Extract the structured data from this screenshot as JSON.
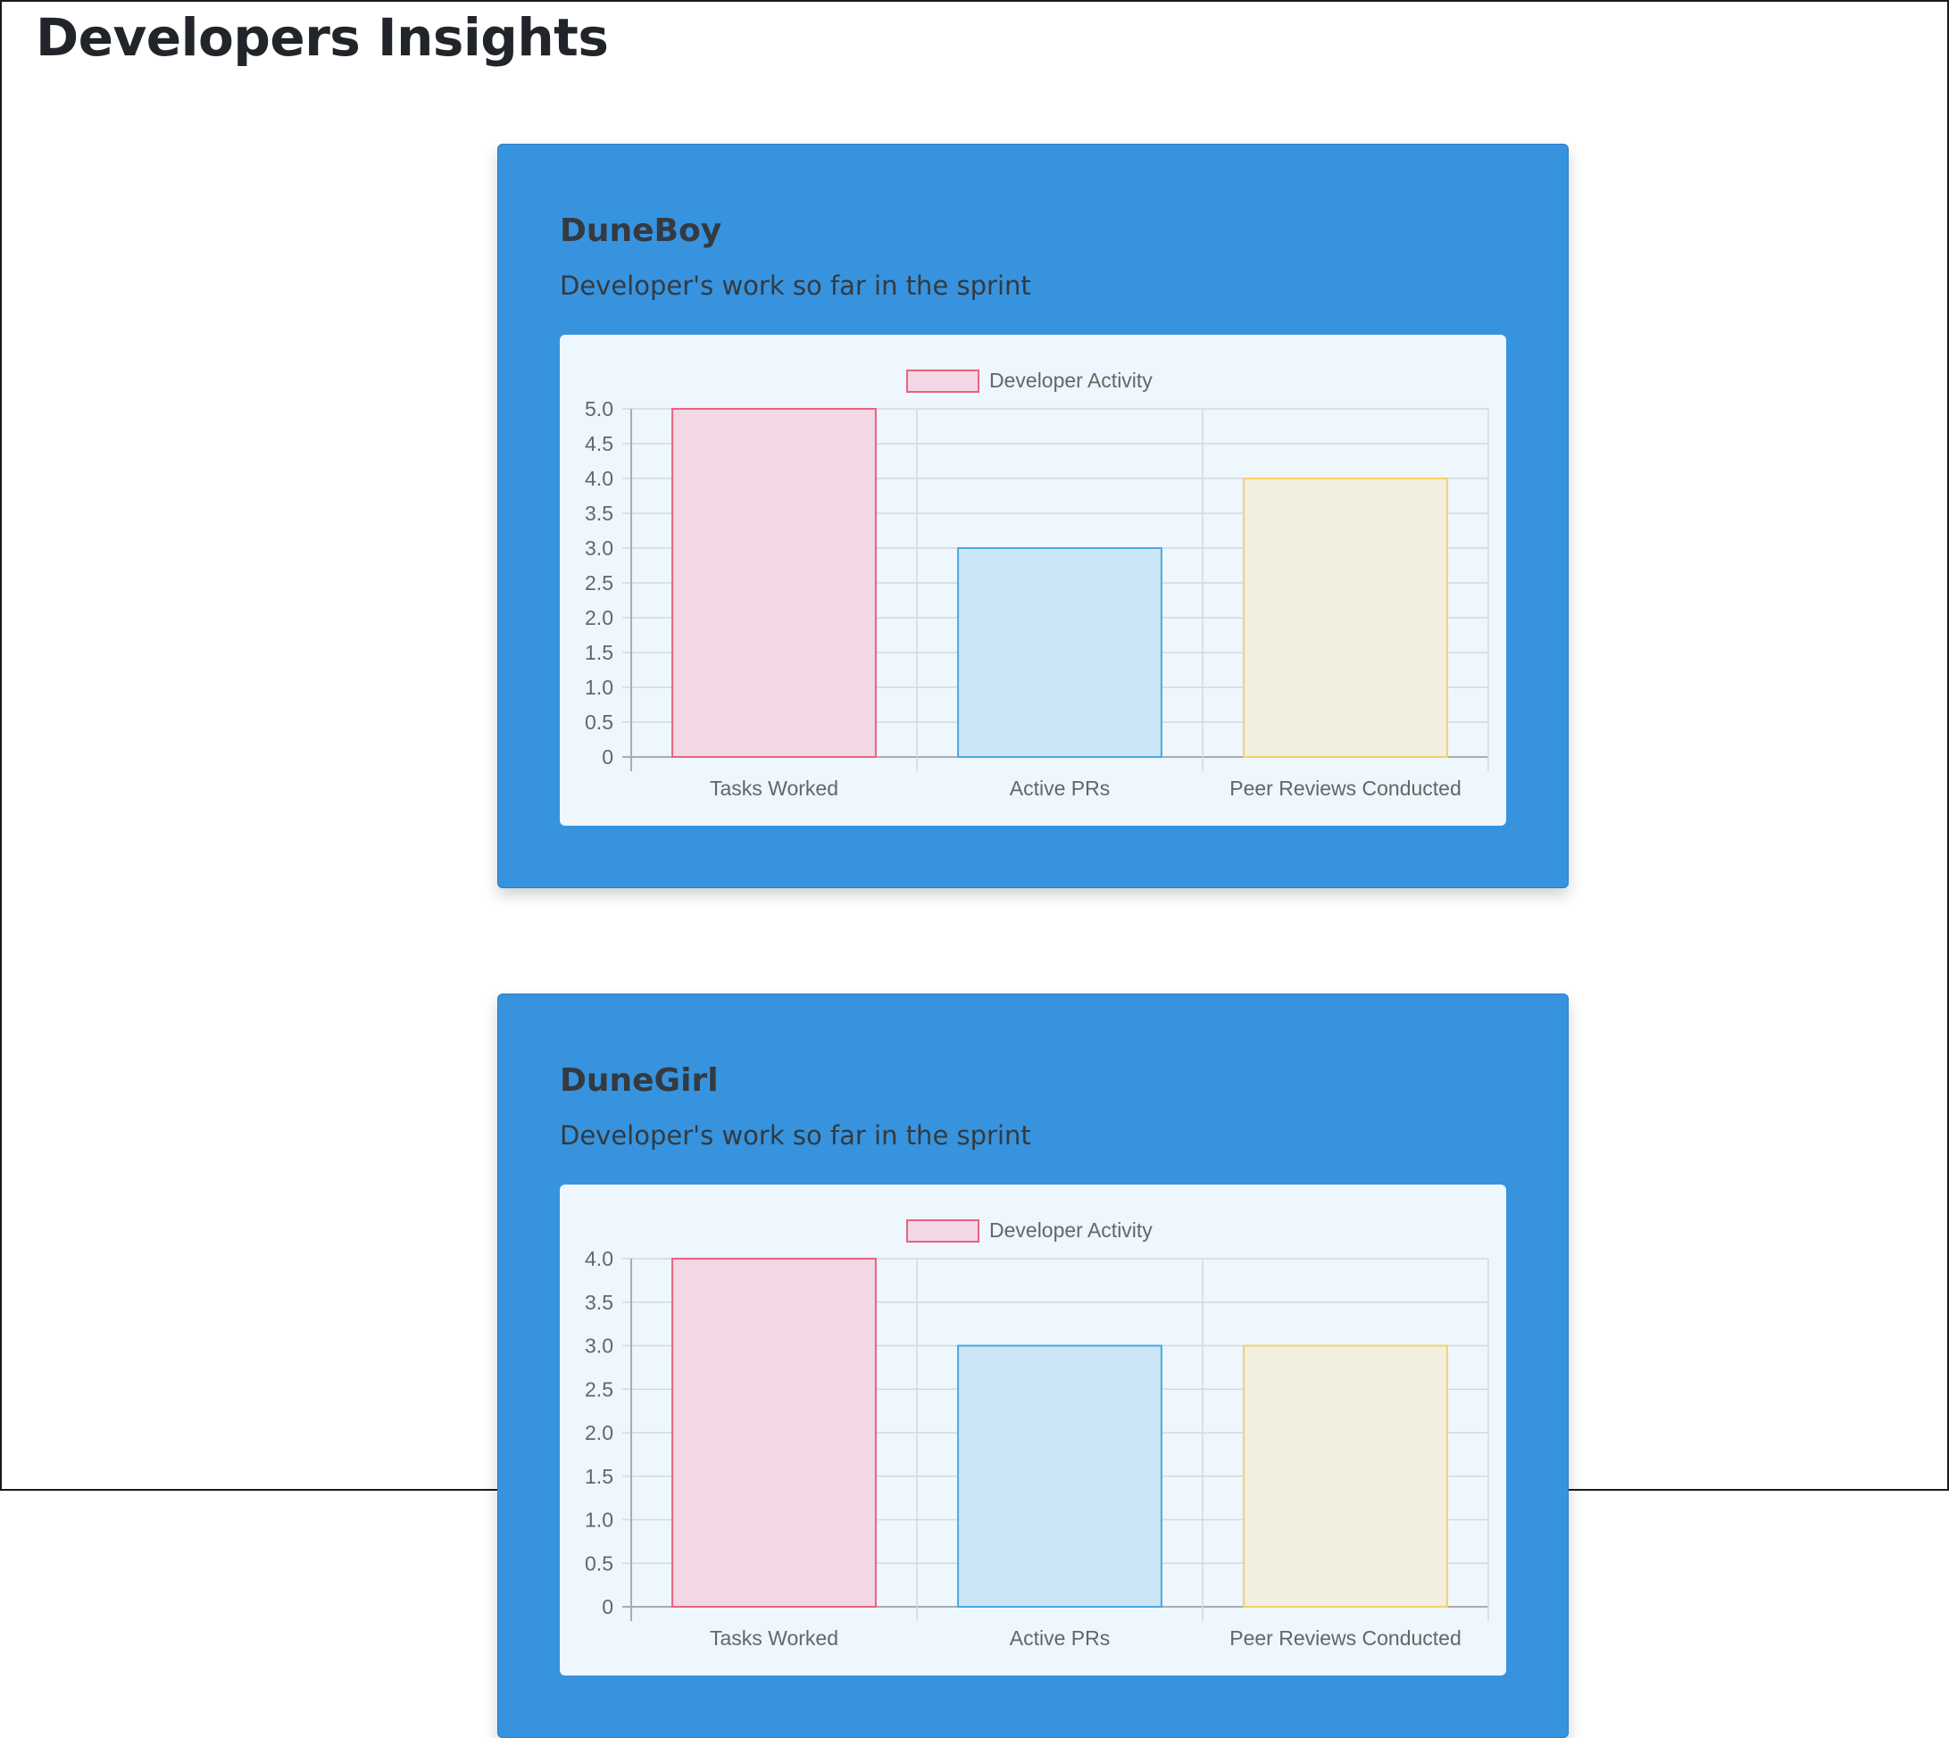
{
  "page": {
    "title": "Developers Insights"
  },
  "developers": [
    {
      "name": "DuneBoy",
      "description": "Developer's work so far in the sprint"
    },
    {
      "name": "DuneGirl",
      "description": "Developer's work so far in the sprint"
    }
  ],
  "colors": {
    "card_background": "#3793de",
    "panel_background": "#eef6fe",
    "bar_fills": [
      "#f2d8e5",
      "#cde6f7",
      "#f2efe0"
    ],
    "bar_borders": [
      "#e8637f",
      "#4aa8e0",
      "#f5cf6e"
    ]
  },
  "chart_data": [
    {
      "type": "bar",
      "legend": [
        "Developer Activity"
      ],
      "legend_placement": "top",
      "grid": true,
      "categories": [
        "Tasks Worked",
        "Active PRs",
        "Peer Reviews Conducted"
      ],
      "series": [
        {
          "name": "Developer Activity",
          "values": [
            5,
            3,
            4
          ]
        }
      ],
      "ylim": [
        0,
        5
      ],
      "yticks": [
        "0",
        "0.5",
        "1.0",
        "1.5",
        "2.0",
        "2.5",
        "3.0",
        "3.5",
        "4.0",
        "4.5",
        "5.0"
      ]
    },
    {
      "type": "bar",
      "legend": [
        "Developer Activity"
      ],
      "legend_placement": "top",
      "grid": true,
      "categories": [
        "Tasks Worked",
        "Active PRs",
        "Peer Reviews Conducted"
      ],
      "series": [
        {
          "name": "Developer Activity",
          "values": [
            4,
            3,
            3
          ]
        }
      ],
      "ylim": [
        0,
        4
      ],
      "yticks": [
        "0",
        "0.5",
        "1.0",
        "1.5",
        "2.0",
        "2.5",
        "3.0",
        "3.5",
        "4.0"
      ]
    }
  ]
}
